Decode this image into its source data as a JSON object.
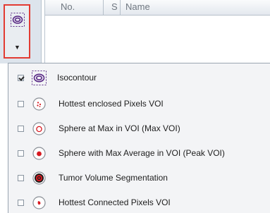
{
  "table": {
    "columns": [
      "No.",
      "S",
      "Name"
    ]
  },
  "split_button": {
    "icon": "isocontour-icon",
    "arrow": "▼"
  },
  "menu": {
    "items": [
      {
        "label": "Isocontour",
        "checked": true,
        "icon": "isocontour-icon"
      },
      {
        "label": "Hottest enclosed Pixels VOI",
        "checked": false,
        "icon": "hottest-enclosed-pixels-icon"
      },
      {
        "label": "Sphere at Max in VOI (Max VOI)",
        "checked": false,
        "icon": "sphere-at-max-icon"
      },
      {
        "label": "Sphere with Max Average in VOI (Peak VOI)",
        "checked": false,
        "icon": "sphere-max-average-icon"
      },
      {
        "label": "Tumor Volume Segmentation",
        "checked": false,
        "icon": "tumor-volume-segmentation-icon"
      },
      {
        "label": "Hottest Connected Pixels VOI",
        "checked": false,
        "icon": "hottest-connected-pixels-icon"
      }
    ]
  },
  "colors": {
    "highlight_border": "#e23b32",
    "icon_purple": "#5a2a86",
    "icon_red": "#d71920"
  }
}
